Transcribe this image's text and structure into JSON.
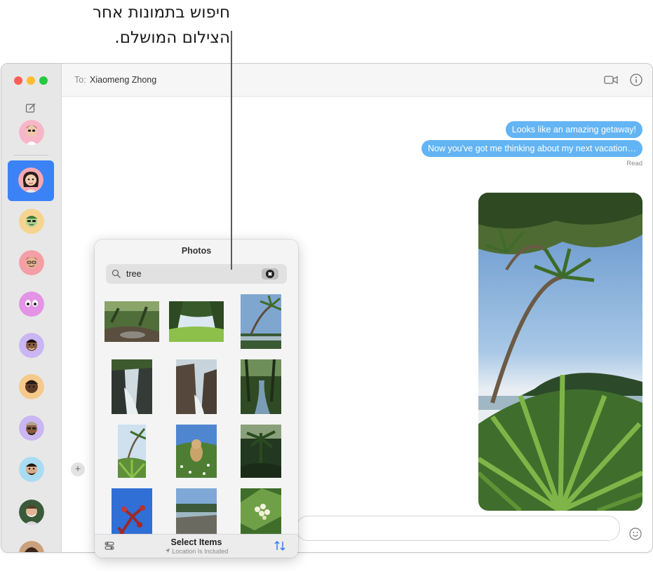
{
  "annotation": {
    "line1": "חיפוש בתמונות אחר",
    "line2": "הצילום המושלם."
  },
  "header": {
    "to_label": "To:",
    "recipient": "Xiaomeng Zhong"
  },
  "icons": {
    "compose": "compose-icon",
    "facetime": "video-camera-icon",
    "info": "info-icon",
    "search": "magnifier-icon",
    "clear": "clear-circle-icon",
    "sort": "sort-arrows-icon",
    "emoji": "smiley-icon",
    "plus": "plus-icon",
    "location": "location-arrow-icon"
  },
  "conversation": {
    "messages": [
      "Looks like an amazing getaway!",
      "Now you've got me thinking about my next vacation…"
    ],
    "status": "Read"
  },
  "photos_popover": {
    "title": "Photos",
    "search_value": "tree",
    "select_items": "Select Items",
    "location_note": "Location Is Included",
    "thumbnails": [
      "forest-stream",
      "green-meadow",
      "palm-tree-coast",
      "rocky-waterfall",
      "coastal-rocks",
      "river-trees",
      "palm-garden",
      "dog-in-flowers",
      "dark-jungle",
      "red-leaves-sky",
      "beach-shore",
      "white-flowers"
    ]
  },
  "input": {
    "plus_label": "+"
  },
  "colors": {
    "bubble_blue": "#63b4f3",
    "selected_blue": "#3b82f6",
    "sidebar_bg": "#e7e7e7"
  }
}
